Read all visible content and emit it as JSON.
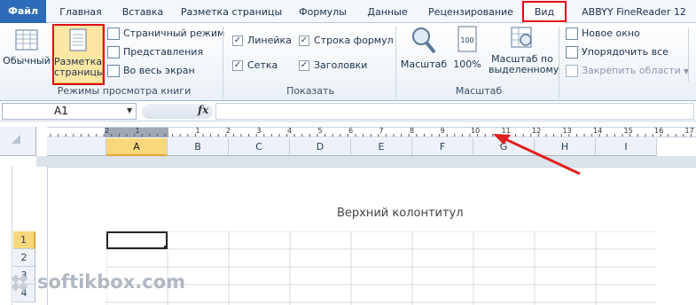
{
  "menu": {
    "file": "Файл",
    "tabs": [
      "Главная",
      "Вставка",
      "Разметка страницы",
      "Формулы",
      "Данные",
      "Рецензирование",
      "Вид",
      "ABBYY FineReader 12"
    ]
  },
  "ribbon": {
    "views_group": {
      "normal": "Обычный",
      "page_layout_line1": "Разметка",
      "page_layout_line2": "страницы",
      "page_break": "Страничный режим",
      "custom_views": "Представления",
      "full_screen": "Во весь экран",
      "label": "Режимы просмотра книги"
    },
    "show_group": {
      "ruler": "Линейка",
      "formula_bar": "Строка формул",
      "gridlines": "Сетка",
      "headings": "Заголовки",
      "label": "Показать"
    },
    "zoom_group": {
      "zoom": "Масштаб",
      "hundred": "100%",
      "zoom_sel_line1": "Масштаб по",
      "zoom_sel_line2": "выделенному",
      "label": "Масштаб"
    },
    "window_group": {
      "new_window": "Новое окно",
      "arrange_all": "Упорядочить все",
      "freeze_panes": "Закрепить области"
    }
  },
  "formula_bar": {
    "name_box": "A1",
    "fx": "fx"
  },
  "ruler_numbers": [
    "1",
    "2",
    "3",
    "4",
    "5",
    "6",
    "7",
    "8",
    "9",
    "10",
    "11",
    "12",
    "13",
    "14",
    "15",
    "16",
    "17"
  ],
  "columns": [
    "A",
    "B",
    "C",
    "D",
    "E",
    "F",
    "G",
    "H",
    "I"
  ],
  "rows": [
    "1",
    "2",
    "3",
    "4"
  ],
  "page": {
    "header_placeholder": "Верхний колонтитул"
  },
  "watermark": "softikbox.com",
  "colors": {
    "accent_red": "#e30613",
    "selected_header": "#f9d77c",
    "file_tab": "#2b6bb8"
  }
}
